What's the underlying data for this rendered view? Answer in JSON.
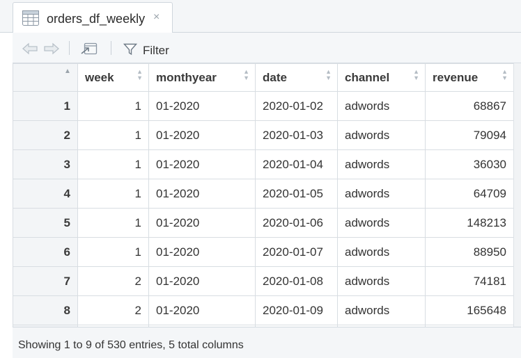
{
  "tab": {
    "title": "orders_df_weekly",
    "close_glyph": "×"
  },
  "toolbar": {
    "filter_label": "Filter"
  },
  "table": {
    "columns": [
      "week",
      "monthyear",
      "date",
      "channel",
      "revenue"
    ],
    "rows": [
      {
        "n": "1",
        "week": "1",
        "monthyear": "01-2020",
        "date": "2020-01-02",
        "channel": "adwords",
        "revenue": "68867"
      },
      {
        "n": "2",
        "week": "1",
        "monthyear": "01-2020",
        "date": "2020-01-03",
        "channel": "adwords",
        "revenue": "79094"
      },
      {
        "n": "3",
        "week": "1",
        "monthyear": "01-2020",
        "date": "2020-01-04",
        "channel": "adwords",
        "revenue": "36030"
      },
      {
        "n": "4",
        "week": "1",
        "monthyear": "01-2020",
        "date": "2020-01-05",
        "channel": "adwords",
        "revenue": "64709"
      },
      {
        "n": "5",
        "week": "1",
        "monthyear": "01-2020",
        "date": "2020-01-06",
        "channel": "adwords",
        "revenue": "148213"
      },
      {
        "n": "6",
        "week": "1",
        "monthyear": "01-2020",
        "date": "2020-01-07",
        "channel": "adwords",
        "revenue": "88950"
      },
      {
        "n": "7",
        "week": "2",
        "monthyear": "01-2020",
        "date": "2020-01-08",
        "channel": "adwords",
        "revenue": "74181"
      },
      {
        "n": "8",
        "week": "2",
        "monthyear": "01-2020",
        "date": "2020-01-09",
        "channel": "adwords",
        "revenue": "165648"
      }
    ]
  },
  "status": {
    "text": "Showing 1 to 9 of 530 entries, 5 total columns"
  },
  "icons": {
    "data-grid": "table-grid-icon",
    "back": "back-arrow-icon",
    "forward": "forward-arrow-icon",
    "popout": "popout-window-icon",
    "filter": "funnel-icon"
  },
  "colors": {
    "header_bg": "#f3f5f7",
    "border": "#d8dde2",
    "text": "#333333"
  }
}
